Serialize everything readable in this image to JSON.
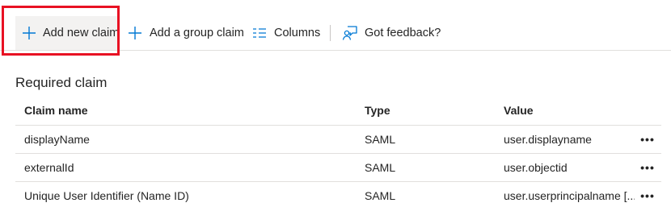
{
  "toolbar": {
    "add_new_claim": "Add new claim",
    "add_group_claim": "Add a group claim",
    "columns": "Columns",
    "got_feedback": "Got feedback?"
  },
  "icons": {
    "add": "plus-icon",
    "columns": "columns-icon",
    "feedback": "feedback-person-icon"
  },
  "colors": {
    "accent": "#0078d4",
    "highlight": "#e81123"
  },
  "section": {
    "title": "Required claim"
  },
  "table": {
    "headers": {
      "name": "Claim name",
      "type": "Type",
      "value": "Value"
    },
    "rows": [
      {
        "name": "displayName",
        "type": "SAML",
        "value": "user.displayname",
        "more": "•••"
      },
      {
        "name": "externalId",
        "type": "SAML",
        "value": "user.objectid",
        "more": "•••"
      },
      {
        "name": "Unique User Identifier (Name ID)",
        "type": "SAML",
        "value": "user.userprincipalname [...",
        "more": "•••"
      }
    ]
  }
}
